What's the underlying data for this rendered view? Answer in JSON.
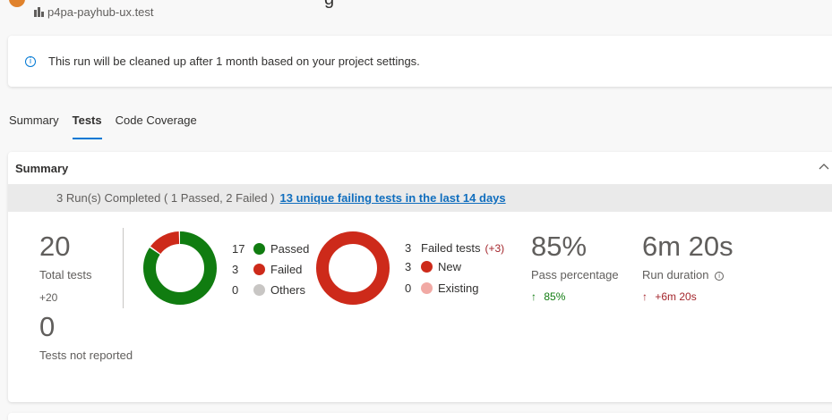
{
  "header": {
    "title_fragment": "g",
    "repo": "p4pa-payhub-ux.test"
  },
  "banner": {
    "text": "This run will be cleaned up after 1 month based on your project settings."
  },
  "tabs": [
    {
      "label": "Summary"
    },
    {
      "label": "Tests",
      "active": true
    },
    {
      "label": "Code Coverage"
    }
  ],
  "summary": {
    "title": "Summary",
    "run_status": "3 Run(s) Completed ( 1 Passed, 2 Failed )",
    "failing_link": "13 unique failing tests in the last 14 days",
    "total_tests": {
      "value": "20",
      "label": "Total tests",
      "delta": "+20"
    },
    "not_reported": {
      "value": "0",
      "label": "Tests not reported"
    },
    "outcome_legend": [
      {
        "count": "17",
        "label": "Passed",
        "color": "#107c10"
      },
      {
        "count": "3",
        "label": "Failed",
        "color": "#cd2a1a"
      },
      {
        "count": "0",
        "label": "Others",
        "color": "#c8c6c4"
      }
    ],
    "failed_legend": {
      "count": "3",
      "label": "Failed tests",
      "delta": "(+3)",
      "items": [
        {
          "count": "3",
          "label": "New",
          "color": "#cd2a1a"
        },
        {
          "count": "0",
          "label": "Existing",
          "color": "#f1a9a4"
        }
      ]
    },
    "pass_percentage": {
      "value": "85%",
      "label": "Pass percentage",
      "delta": "85%"
    },
    "run_duration": {
      "value": "6m 20s",
      "label": "Run duration",
      "delta": "+6m 20s"
    }
  },
  "chart_data": [
    {
      "type": "pie",
      "categories": [
        "Passed",
        "Failed",
        "Others"
      ],
      "values": [
        17,
        3,
        0
      ],
      "colors": [
        "#107c10",
        "#cd2a1a",
        "#c8c6c4"
      ]
    },
    {
      "type": "pie",
      "categories": [
        "New",
        "Existing"
      ],
      "values": [
        3,
        0
      ],
      "colors": [
        "#cd2a1a",
        "#f1a9a4"
      ]
    }
  ],
  "colors": {
    "accent": "#0078d4",
    "link": "#106ebe",
    "passed": "#107c10",
    "failed": "#cd2a1a",
    "delta_up_good": "#107c10",
    "delta_up_bad": "#a4262c"
  },
  "icons": {
    "info": "info-icon",
    "repo": "repo-icon",
    "collapse": "chevron-up-icon",
    "arrow_up": "arrow-up-icon",
    "duration_info": "info-icon"
  }
}
